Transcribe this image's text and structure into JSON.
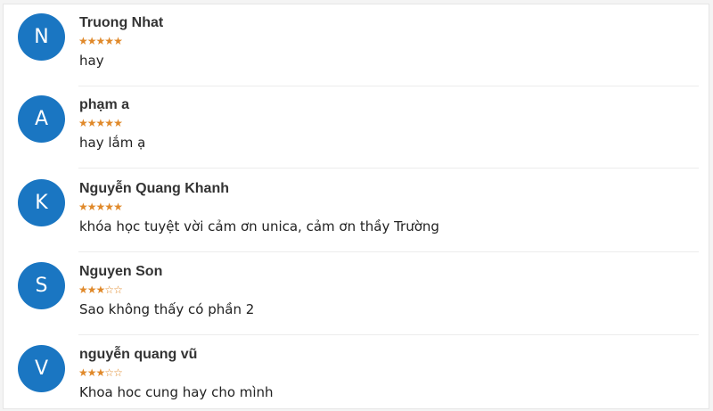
{
  "reviews": [
    {
      "initial": "N",
      "name": "Truong Nhat",
      "rating": 5,
      "max_rating": 5,
      "comment": "hay"
    },
    {
      "initial": "A",
      "name": "phạm a",
      "rating": 5,
      "max_rating": 5,
      "comment": "hay lắm ạ"
    },
    {
      "initial": "K",
      "name": "Nguyễn Quang Khanh",
      "rating": 5,
      "max_rating": 5,
      "comment": "khóa học tuyệt vời cảm ơn unica, cảm ơn thầy Trường"
    },
    {
      "initial": "S",
      "name": "Nguyen Son",
      "rating": 3,
      "max_rating": 5,
      "comment": "Sao không thấy có phần 2"
    },
    {
      "initial": "V",
      "name": "nguyễn quang vũ",
      "rating": 3,
      "max_rating": 5,
      "comment": "Khoa hoc cung hay cho mình"
    }
  ],
  "colors": {
    "avatar_bg": "#1a76c2",
    "star": "#e0892a"
  },
  "icons": {
    "star_filled": "star-filled-icon",
    "star_empty": "star-empty-icon"
  }
}
